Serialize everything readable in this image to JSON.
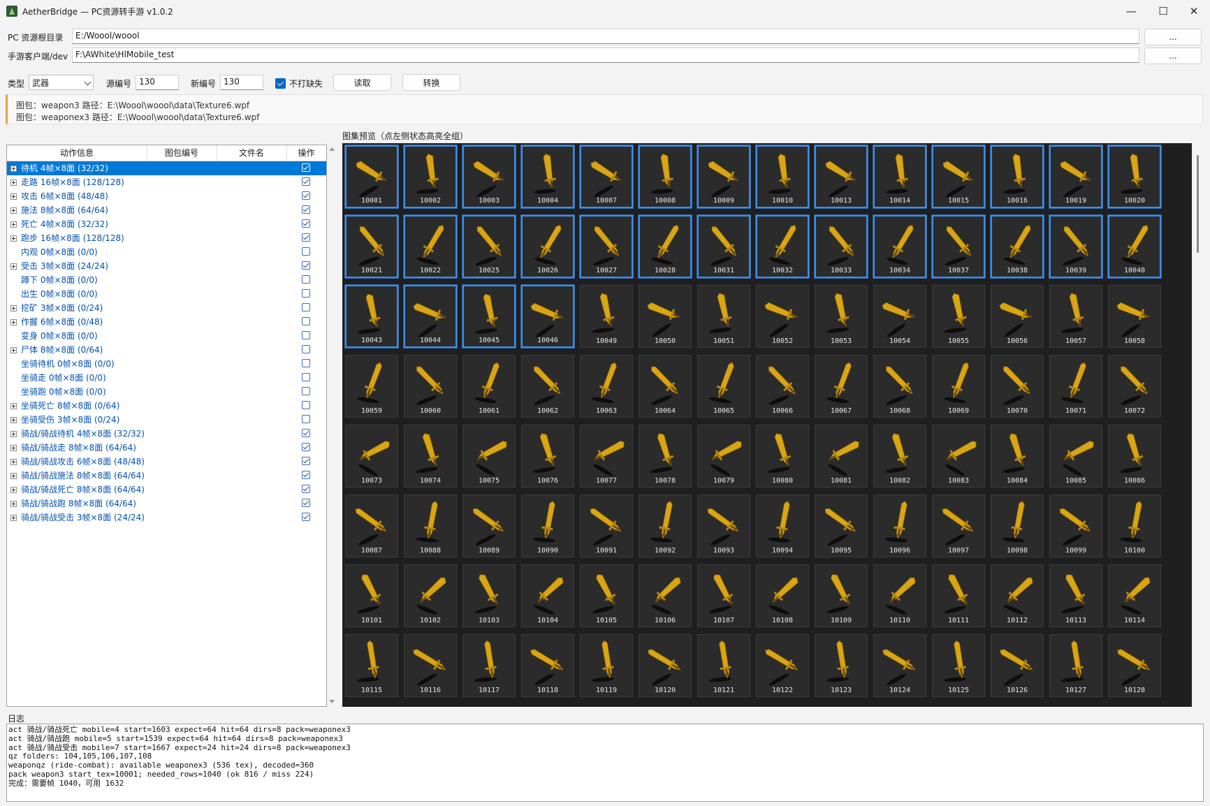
{
  "window": {
    "title": "AetherBridge — PC资源转手游  v1.0.2",
    "minimize_glyph": "—",
    "maximize_glyph": "☐",
    "close_glyph": "✕"
  },
  "paths": {
    "pc_label": "PC 资源根目录",
    "pc_value": "E:/Woool/woool",
    "pc_browse": "...",
    "mobile_label": "手游客户端/dev",
    "mobile_value": "F:\\AWhite\\HlMobile_test",
    "mobile_browse": "..."
  },
  "toolbar": {
    "type_label": "类型",
    "type_value": "武器",
    "src_label": "源编号",
    "src_value": "130",
    "new_label": "新编号",
    "new_value": "130",
    "nomiss_label": "不打缺失",
    "nomiss_checked": true,
    "read_button": "读取",
    "convert_button": "转换"
  },
  "info": {
    "line1": "图包：weapon3    路径：E:\\Woool\\woool\\data\\Texture6.wpf",
    "line2": "图包：weaponex3    路径：E:\\Woool\\woool\\data\\Texture6.wpf"
  },
  "tree": {
    "columns": [
      "动作信息",
      "图包编号",
      "文件名",
      "操作"
    ],
    "rows": [
      {
        "label": "待机   4帧×8面 (32/32)",
        "expandable": true,
        "checked": true,
        "selected": true
      },
      {
        "label": "走路   16帧×8面 (128/128)",
        "expandable": true,
        "checked": true
      },
      {
        "label": "攻击   6帧×8面 (48/48)",
        "expandable": true,
        "checked": true
      },
      {
        "label": "施法   8帧×8面 (64/64)",
        "expandable": true,
        "checked": true
      },
      {
        "label": "死亡   4帧×8面 (32/32)",
        "expandable": true,
        "checked": true
      },
      {
        "label": "跑步   16帧×8面 (128/128)",
        "expandable": true,
        "checked": true
      },
      {
        "label": "内观   0帧×8面 (0/0)",
        "expandable": false,
        "checked": false
      },
      {
        "label": "受击   3帧×8面 (24/24)",
        "expandable": true,
        "checked": true
      },
      {
        "label": "蹲下   0帧×8面 (0/0)",
        "expandable": false,
        "checked": false
      },
      {
        "label": "出生   0帧×8面 (0/0)",
        "expandable": false,
        "checked": false
      },
      {
        "label": "挖矿   3帧×8面 (0/24)",
        "expandable": true,
        "checked": false
      },
      {
        "label": "作握   6帧×8面 (0/48)",
        "expandable": true,
        "checked": false
      },
      {
        "label": "变身   0帧×8面 (0/0)",
        "expandable": false,
        "checked": false
      },
      {
        "label": "尸体   8帧×8面 (0/64)",
        "expandable": true,
        "checked": false
      },
      {
        "label": "坐骑待机   0帧×8面 (0/0)",
        "expandable": false,
        "checked": false
      },
      {
        "label": "坐骑走   0帧×8面 (0/0)",
        "expandable": false,
        "checked": false
      },
      {
        "label": "坐骑跑   0帧×8面 (0/0)",
        "expandable": false,
        "checked": false
      },
      {
        "label": "坐骑死亡   8帧×8面 (0/64)",
        "expandable": true,
        "checked": false
      },
      {
        "label": "坐骑受伤   3帧×8面 (0/24)",
        "expandable": true,
        "checked": false
      },
      {
        "label": "骑战/骑战待机   4帧×8面 (32/32)",
        "expandable": true,
        "checked": true
      },
      {
        "label": "骑战/骑战走   8帧×8面 (64/64)",
        "expandable": true,
        "checked": true
      },
      {
        "label": "骑战/骑战攻击   6帧×8面 (48/48)",
        "expandable": true,
        "checked": true
      },
      {
        "label": "骑战/骑战施法   8帧×8面 (64/64)",
        "expandable": true,
        "checked": true
      },
      {
        "label": "骑战/骑战死亡   8帧×8面 (64/64)",
        "expandable": true,
        "checked": true
      },
      {
        "label": "骑战/骑战跑   8帧×8面 (64/64)",
        "expandable": true,
        "checked": true
      },
      {
        "label": "骑战/骑战受击   3帧×8面 (24/24)",
        "expandable": true,
        "checked": true
      }
    ]
  },
  "preview": {
    "label": "图集预览（点左侧状态高亮全组）",
    "highlighted_count": 32,
    "tiles": [
      "10001",
      "10002",
      "10003",
      "10004",
      "10007",
      "10008",
      "10009",
      "10010",
      "10013",
      "10014",
      "10015",
      "10016",
      "10019",
      "10020",
      "10021",
      "10022",
      "10025",
      "10026",
      "10027",
      "10028",
      "10031",
      "10032",
      "10033",
      "10034",
      "10037",
      "10038",
      "10039",
      "10040",
      "10043",
      "10044",
      "10045",
      "10046",
      "10049",
      "10050",
      "10051",
      "10052",
      "10053",
      "10054",
      "10055",
      "10056",
      "10057",
      "10058",
      "10059",
      "10060",
      "10061",
      "10062",
      "10063",
      "10064",
      "10065",
      "10066",
      "10067",
      "10068",
      "10069",
      "10070",
      "10071",
      "10072",
      "10073",
      "10074",
      "10075",
      "10076",
      "10077",
      "10078",
      "10079",
      "10080",
      "10081",
      "10082",
      "10083",
      "10084",
      "10085",
      "10086",
      "10087",
      "10088",
      "10089",
      "10090",
      "10091",
      "10092",
      "10093",
      "10094",
      "10095",
      "10096",
      "10097",
      "10098",
      "10099",
      "10100",
      "10101",
      "10102",
      "10103",
      "10104",
      "10105",
      "10106",
      "10107",
      "10108",
      "10109",
      "10110",
      "10111",
      "10112",
      "10113",
      "10114",
      "10115",
      "10116",
      "10117",
      "10118",
      "10119",
      "10120",
      "10121",
      "10122",
      "10123",
      "10124",
      "10125",
      "10126",
      "10127",
      "10128"
    ]
  },
  "log": {
    "label": "日志",
    "lines": [
      "act 骑战/骑战死亡 mobile=4 start=1603 expect=64 hit=64 dirs=8 pack=weaponex3",
      "act 骑战/骑战跑 mobile=5 start=1539 expect=64 hit=64 dirs=8 pack=weaponex3",
      "act 骑战/骑战受击 mobile=7 start=1667 expect=24 hit=24 dirs=8 pack=weaponex3",
      "qz folders: 104,105,106,107,108",
      "weaponqz (ride-combat): available weaponex3 (536 tex), decoded=360",
      "pack weapon3 start_tex=10001; needed_rows=1040 (ok 816 / miss 224)",
      "完成：需要帧 1040，可用 1632"
    ]
  },
  "colors": {
    "accent": "#0078d7",
    "highlight_border": "#3f8ee6",
    "weapon_gold": "#d9a514",
    "gallery_bg": "#1f1f1f",
    "info_accent": "#e8a23c"
  }
}
